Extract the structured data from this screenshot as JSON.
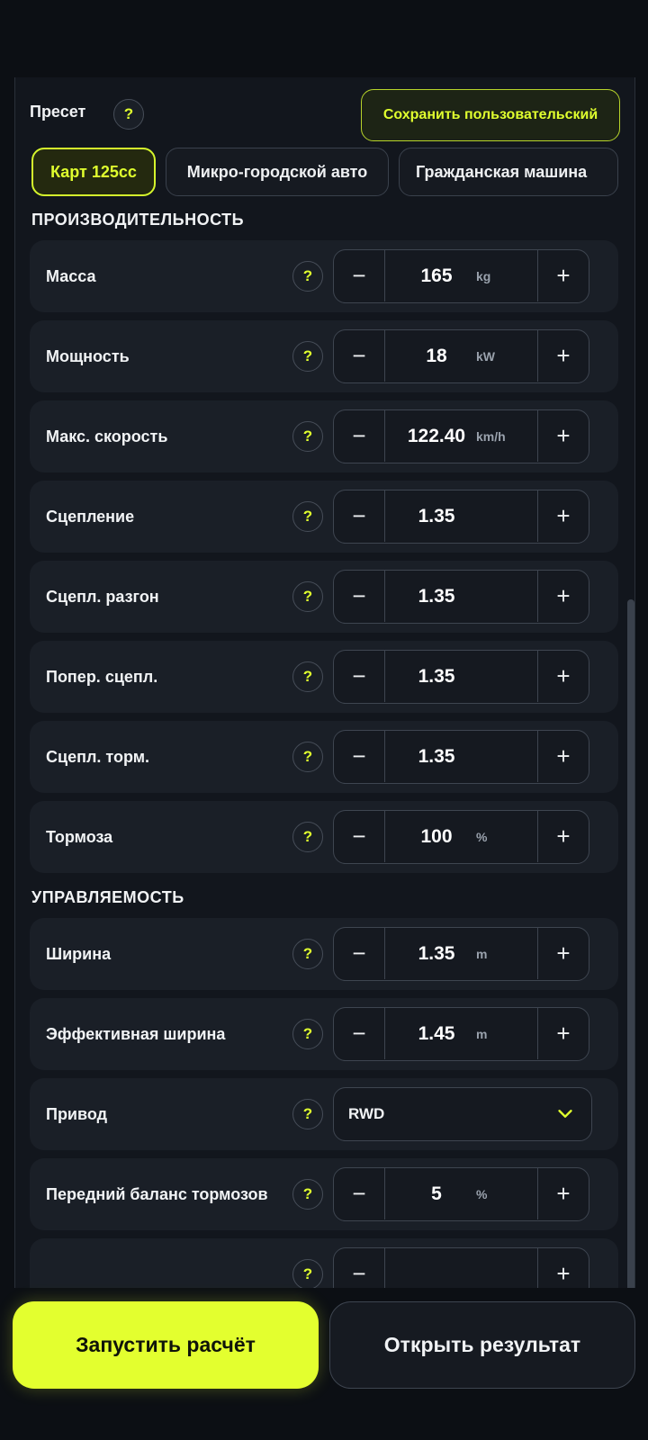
{
  "preset": {
    "label": "Пресет",
    "help": "?",
    "save_label": "Сохранить пользовательский",
    "chips": [
      "Карт 125cc",
      "Микро-городской авто",
      "Гражданская машина"
    ]
  },
  "sections": {
    "performance": "ПРОИЗВОДИТЕЛЬНОСТЬ",
    "handling": "УПРАВЛЯЕМОСТЬ"
  },
  "performance": [
    {
      "label": "Масса",
      "value": "165",
      "unit": "kg"
    },
    {
      "label": "Мощность",
      "value": "18",
      "unit": "kW"
    },
    {
      "label": "Макс. скорость",
      "value": "122.40",
      "unit": "km/h"
    },
    {
      "label": "Сцепление",
      "value": "1.35",
      "unit": ""
    },
    {
      "label": "Сцепл. разгон",
      "value": "1.35",
      "unit": ""
    },
    {
      "label": "Попер. сцепл.",
      "value": "1.35",
      "unit": ""
    },
    {
      "label": "Сцепл. торм.",
      "value": "1.35",
      "unit": ""
    },
    {
      "label": "Тормоза",
      "value": "100",
      "unit": "%"
    }
  ],
  "handling": [
    {
      "label": "Ширина",
      "value": "1.35",
      "unit": "m"
    },
    {
      "label": "Эффективная ширина",
      "value": "1.45",
      "unit": "m"
    },
    {
      "label": "Привод",
      "value": "RWD",
      "type": "dropdown"
    },
    {
      "label": "Передний баланс тормозов",
      "value": "5",
      "unit": "%"
    }
  ],
  "controls": {
    "minus": "−",
    "plus": "+",
    "help": "?"
  },
  "actions": {
    "run_label": "Запустить расчёт",
    "open_label": "Открыть результат"
  },
  "colors": {
    "accent": "#E3FF2F",
    "background": "#0C0F14",
    "card": "#1A1F27",
    "border": "#3E4550"
  },
  "icons": {
    "help": "question-icon",
    "dropdown": "chevron-down-icon",
    "minus": "minus-icon",
    "plus": "plus-icon"
  }
}
